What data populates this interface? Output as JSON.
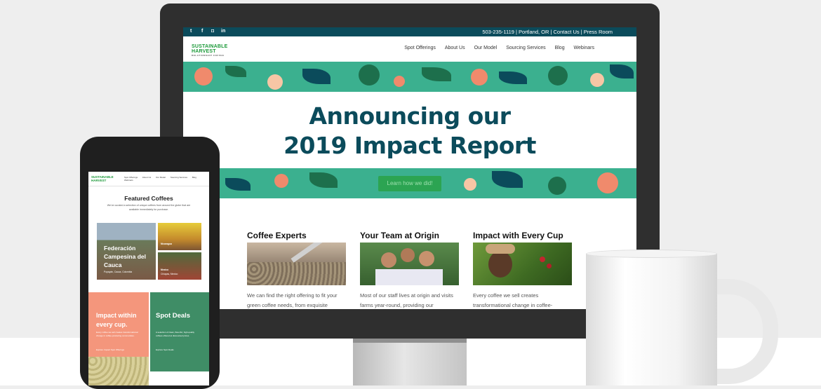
{
  "desktop": {
    "social_icons": [
      "twitter-icon",
      "facebook-icon",
      "instagram-icon",
      "linkedin-icon"
    ],
    "social_glyphs": [
      "t",
      "f",
      "◘",
      "in"
    ],
    "top_info": "503-235-1119 | Portland, OR | Contact Us | Press Room",
    "logo": {
      "line1": "SUSTAINABLE",
      "line2": "HARVEST",
      "tagline": "RELATIONSHIP COFFEE"
    },
    "menu": [
      "Spot Offerings",
      "About Us",
      "Our Model",
      "Sourcing Services",
      "Blog",
      "Webinars"
    ],
    "headline_line1": "Announcing our",
    "headline_line2": "2019 Impact Report",
    "cta_label": "Learn how we did!",
    "columns": [
      {
        "title": "Coffee Experts",
        "text": "We can find the right offering to fit your green coffee needs, from exquisite"
      },
      {
        "title": "Your Team at Origin",
        "text": "Most of our staff lives at origin and visits farms year-round, providing our"
      },
      {
        "title": "Impact with Every Cup",
        "text": "Every coffee we sell creates transformational change in coffee-"
      }
    ]
  },
  "mobile": {
    "logo": {
      "line1": "SUSTAINABLE",
      "line2": "HARVEST"
    },
    "menu": [
      "Spot Offerings",
      "About Us",
      "Our Model",
      "Sourcing Services",
      "Blog",
      "Webinars"
    ],
    "featured_title": "Featured Coffees",
    "featured_desc": "We've curated a selection of unique coffees from around the globe that are available immediately for purchase.",
    "big_card_title": "Federación Campesina del Cauca",
    "big_card_sub": "Popayán, Cauca, Colombia",
    "small_card_title": "Nicaragua",
    "small_card_sub": "Matagalpa, Nicaragua",
    "card_bottom_title": "Mexico",
    "card_bottom_sub": "Chiapas, Mexico",
    "impact_title": "Impact within every cup.",
    "impact_desc": "Every coffee we sell creates transformational change in coffee-producing communities.",
    "impact_link": "Explore Impact Spot Offerings",
    "spot_title": "Spot Deals",
    "spot_desc": "A selection of clean, flavorful, high-quality coffees offered at discounted prices.",
    "spot_link": "Explore Spot Deals"
  },
  "colors": {
    "teal_dark": "#0b4b5b",
    "green_band": "#3bb08f",
    "brand_green": "#1d9a3a",
    "salmon": "#f4967c",
    "forest": "#3f8d66"
  }
}
